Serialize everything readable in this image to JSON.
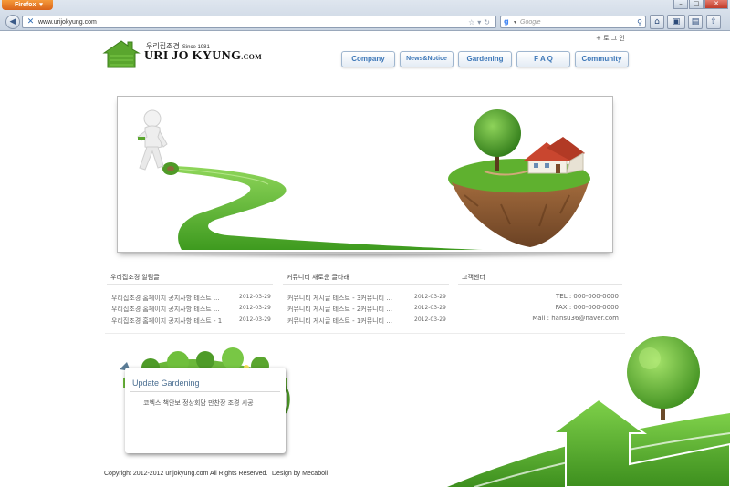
{
  "browser": {
    "app_menu_label": "Firefox",
    "url": "www.urijokyung.com",
    "search_placeholder": "Google",
    "window_buttons": [
      "–",
      "□",
      "✕"
    ]
  },
  "site": {
    "logo": {
      "sub_label": "우리집조경",
      "since": "Since 1981",
      "name": "URI JO KYUNG",
      "suffix": ".COM"
    },
    "login_label": "+ 로 그 인",
    "menu": [
      "Company",
      "News&Notice",
      "Gardening",
      "F A Q",
      "Community"
    ]
  },
  "notice": {
    "title": "우리집조경 알림글",
    "items": [
      {
        "title": "우리집조경 홈페이지 공지사항 테스트 ...",
        "date": "2012-03-29"
      },
      {
        "title": "우리집조경 홈페이지 공지사항 테스트 ...",
        "date": "2012-03-29"
      },
      {
        "title": "우리집조경 홈페이지 공지사항 테스트 - 1",
        "date": "2012-03-29"
      }
    ]
  },
  "community": {
    "title": "커뮤니티 새로운 글타래",
    "items": [
      {
        "title": "커뮤니티 게시글 테스트 - 3커뮤니티 ...",
        "date": "2012-03-29"
      },
      {
        "title": "커뮤니티 게시글 테스트 - 2커뮤니티 ...",
        "date": "2012-03-29"
      },
      {
        "title": "커뮤니티 게시글 테스트 - 1커뮤니티 ...",
        "date": "2012-03-29"
      }
    ]
  },
  "customer": {
    "title": "고객센터",
    "tel": "TEL : 000-000-0000",
    "fax": "FAX : 000-000-0000",
    "mail": "Mail : hansu36@naver.com"
  },
  "update": {
    "title": "Update Gardening",
    "text": "코엑스 책안보 정상회담 만찬장 조경 시공"
  },
  "footer": {
    "copyright": "Copyright 2012-2012 urijokyung.com All Rights Reserved.",
    "design": "Design by Mecaboil"
  },
  "colors": {
    "menu_text": "#3e78b8",
    "grass": "#5aa62e",
    "chrome": "#c9d4e2",
    "firefox_orange": "#e07a22"
  }
}
